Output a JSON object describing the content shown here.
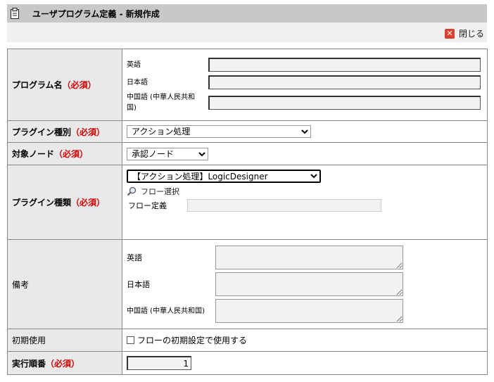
{
  "window": {
    "title": "ユーザプログラム定義 - 新規作成",
    "close_label": "閉じる"
  },
  "form": {
    "required_mark": "（必須）",
    "program_name": {
      "label": "プログラム名",
      "fields": [
        {
          "lang": "英語",
          "value": ""
        },
        {
          "lang": "日本語",
          "value": ""
        },
        {
          "lang_line1": "中国語 (中華人民共和",
          "lang_line2": "国)",
          "value": ""
        }
      ]
    },
    "plugin_category": {
      "label": "プラグイン種別",
      "selected": "アクション処理"
    },
    "target_node": {
      "label": "対象ノード",
      "selected": "承認ノード"
    },
    "plugin_type": {
      "label": "プラグイン種類",
      "selected": "【アクション処理】LogicDesigner",
      "flow_select_label": "フロー選択",
      "flow_def_label": "フロー定義",
      "flow_def_value": ""
    },
    "remarks": {
      "label": "備考",
      "fields": [
        {
          "lang": "英語",
          "value": ""
        },
        {
          "lang": "日本語",
          "value": ""
        },
        {
          "lang": "中国語 (中華人民共和国)",
          "value": ""
        }
      ]
    },
    "initial_use": {
      "label": "初期使用",
      "checkbox_label": "フローの初期設定で使用する",
      "checked": false
    },
    "exec_order": {
      "label": "実行順番",
      "value": "1"
    }
  }
}
